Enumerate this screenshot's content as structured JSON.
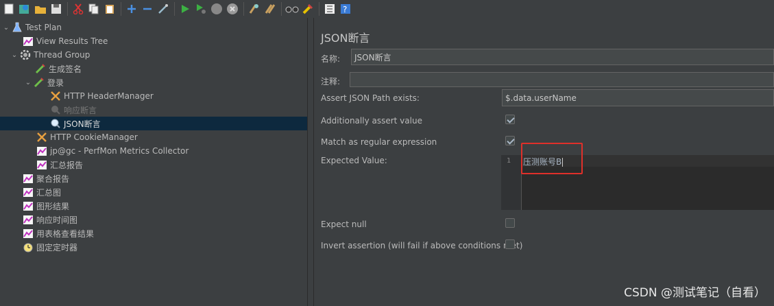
{
  "toolbar": {
    "icons": [
      "new-icon",
      "templates-icon",
      "open-icon",
      "save-icon",
      "cut-icon",
      "copy-icon",
      "paste-icon",
      "expand-icon",
      "collapse-icon",
      "toggle-icon",
      "start-icon",
      "start-no-pauses-icon",
      "stop-icon",
      "shutdown-icon",
      "clear-icon",
      "clear-all-icon",
      "search-icon",
      "reset-search-icon",
      "function-helper-icon",
      "help-icon"
    ]
  },
  "tree": {
    "items": [
      {
        "label": "Test Plan",
        "icon": "flask-icon"
      },
      {
        "label": "View Results Tree",
        "icon": "listener-icon"
      },
      {
        "label": "Thread Group",
        "icon": "gear-icon"
      },
      {
        "label": "生成签名",
        "icon": "sampler-icon"
      },
      {
        "label": "登录",
        "icon": "sampler-icon"
      },
      {
        "label": "HTTP HeaderManager",
        "icon": "config-icon"
      },
      {
        "label": "响应断言",
        "icon": "assertion-icon"
      },
      {
        "label": "JSON断言",
        "icon": "assertion-icon"
      },
      {
        "label": "HTTP CookieManager",
        "icon": "config-icon"
      },
      {
        "label": "jp@gc - PerfMon Metrics Collector",
        "icon": "listener-icon"
      },
      {
        "label": "汇总报告",
        "icon": "listener-icon"
      },
      {
        "label": "聚合报告",
        "icon": "listener-icon"
      },
      {
        "label": "汇总图",
        "icon": "listener-icon"
      },
      {
        "label": "图形结果",
        "icon": "listener-icon"
      },
      {
        "label": "响应时间图",
        "icon": "listener-icon"
      },
      {
        "label": "用表格查看结果",
        "icon": "listener-icon"
      },
      {
        "label": "固定定时器",
        "icon": "timer-icon"
      }
    ],
    "selected": "JSON断言"
  },
  "panel": {
    "title": "JSON断言",
    "name_label": "名称:",
    "name_value": "JSON断言",
    "comment_label": "注释:",
    "comment_value": "",
    "path_label": "Assert JSON Path exists:",
    "path_value": "$.data.userName",
    "additionally_label": "Additionally assert value",
    "additionally_checked": true,
    "regex_label": "Match as regular expression",
    "regex_checked": true,
    "expected_label": "Expected Value:",
    "expected_line_no": "1",
    "expected_value": "压测账号B",
    "expect_null_label": "Expect null",
    "expect_null_checked": false,
    "invert_label": "Invert assertion (will fail if above conditions met)",
    "invert_checked": false
  },
  "watermark": "CSDN @测试笔记（自看）",
  "colors": {
    "highlight": "#e0302a",
    "selected_row": "#0d293e"
  }
}
